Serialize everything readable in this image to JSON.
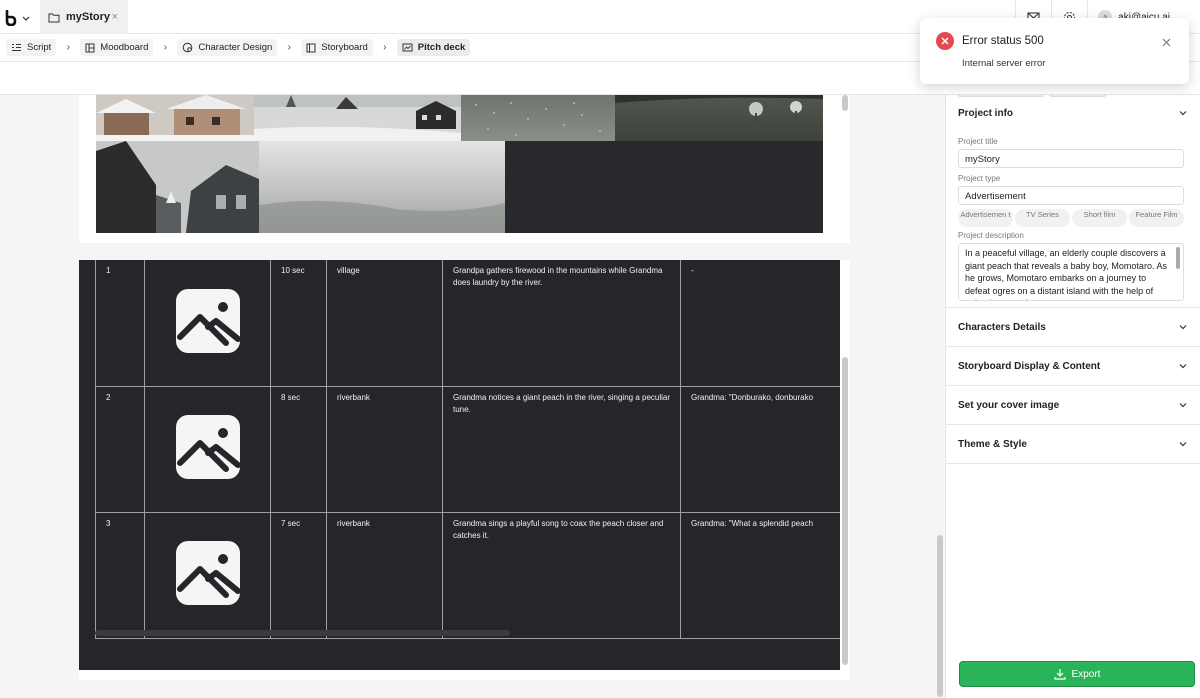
{
  "app": {
    "tab_title": "myStory",
    "tab_close": "×"
  },
  "user": {
    "avatar_initial": "a",
    "email": "aki@aicu.ai"
  },
  "breadcrumbs": [
    {
      "label": "Script",
      "icon": "script-icon"
    },
    {
      "label": "Moodboard",
      "icon": "moodboard-icon"
    },
    {
      "label": "Character Design",
      "icon": "character-design-icon"
    },
    {
      "label": "Storyboard",
      "icon": "storyboard-icon"
    },
    {
      "label": "Pitch deck",
      "icon": "pitch-deck-icon",
      "active": true
    }
  ],
  "storyboard": {
    "rows": [
      {
        "num": "1",
        "duration": "10 sec",
        "location": "village",
        "description": "Grandpa gathers firewood in the mountains while Grandma does laundry by the river.",
        "dialogue": "-"
      },
      {
        "num": "2",
        "duration": "8 sec",
        "location": "riverbank",
        "description": "Grandma notices a giant peach in the river, singing a peculiar tune.",
        "dialogue": "Grandma: \"Donburako, donburako"
      },
      {
        "num": "3",
        "duration": "7 sec",
        "location": "riverbank",
        "description": "Grandma sings a playful song to coax the peach closer and catches it.",
        "dialogue": "Grandma: \"What a splendid peach"
      }
    ]
  },
  "project_info": {
    "header": "Project info",
    "title_label": "Project title",
    "title_value": "myStory",
    "type_label": "Project type",
    "type_value": "Advertisement",
    "type_options": [
      "Advertisemen t",
      "TV Series",
      "Short film",
      "Feature Film"
    ],
    "desc_label": "Project description",
    "desc_value": "In a peaceful village, an elderly couple discovers a giant peach that reveals a baby boy, Momotaro. As he grows, Momotaro embarks on a journey to defeat ogres on a distant island with the help of animal companions."
  },
  "sections": [
    "Characters Details",
    "Storyboard Display & Content",
    "Set your cover image",
    "Theme & Style"
  ],
  "export_label": "Export",
  "toast": {
    "title": "Error status 500",
    "message": "Internal server error"
  },
  "colors": {
    "accent_green": "#2ab45a",
    "error_red": "#e5484d",
    "storyboard_bg": "#25262a"
  }
}
